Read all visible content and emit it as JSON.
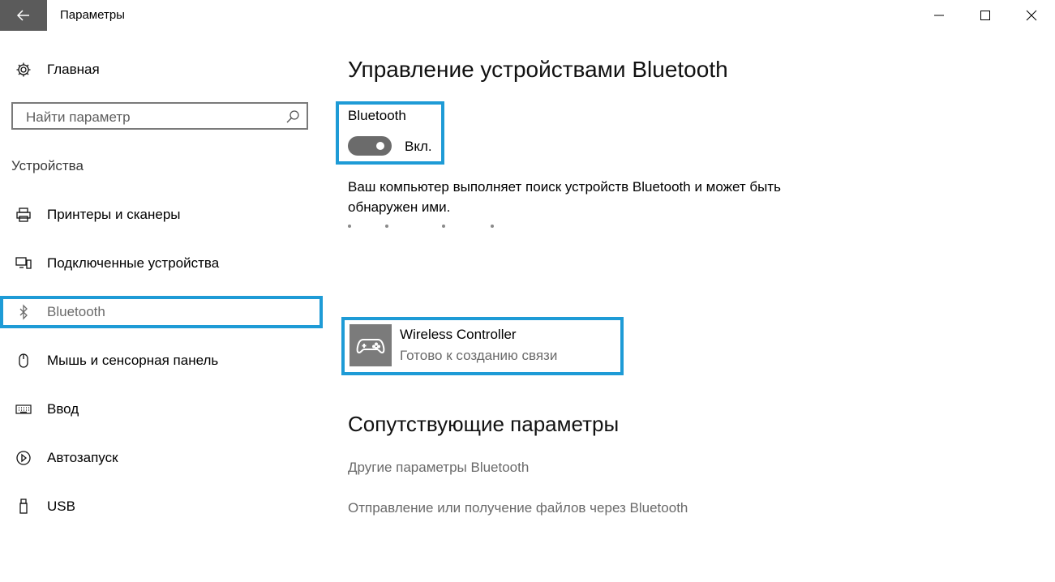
{
  "window": {
    "title": "Параметры"
  },
  "sidebar": {
    "home_label": "Главная",
    "search_placeholder": "Найти параметр",
    "section_label": "Устройства",
    "items": [
      {
        "label": "Принтеры и сканеры",
        "icon": "printer-icon"
      },
      {
        "label": "Подключенные устройства",
        "icon": "connected-devices-icon"
      },
      {
        "label": "Bluetooth",
        "icon": "bluetooth-icon",
        "selected": true
      },
      {
        "label": "Мышь и сенсорная панель",
        "icon": "mouse-icon"
      },
      {
        "label": "Ввод",
        "icon": "keyboard-icon"
      },
      {
        "label": "Автозапуск",
        "icon": "autoplay-icon"
      },
      {
        "label": "USB",
        "icon": "usb-icon"
      }
    ]
  },
  "main": {
    "title": "Управление устройствами Bluetooth",
    "bluetooth_label": "Bluetooth",
    "toggle_state": "Вкл.",
    "description": "Ваш компьютер выполняет поиск устройств Bluetooth и может быть обнаружен ими.",
    "device": {
      "name": "Wireless Controller",
      "status": "Готово к созданию связи",
      "icon": "gamepad-icon"
    },
    "related_title": "Сопутствующие параметры",
    "related_links": [
      "Другие параметры Bluetooth",
      "Отправление или получение файлов через Bluetooth"
    ]
  },
  "colors": {
    "accent": "#1e9bd6",
    "back_button": "#5b5b5b",
    "toggle": "#6b6b6b",
    "device_icon_bg": "#7b7b7b",
    "muted_text": "#6a6a6a"
  }
}
